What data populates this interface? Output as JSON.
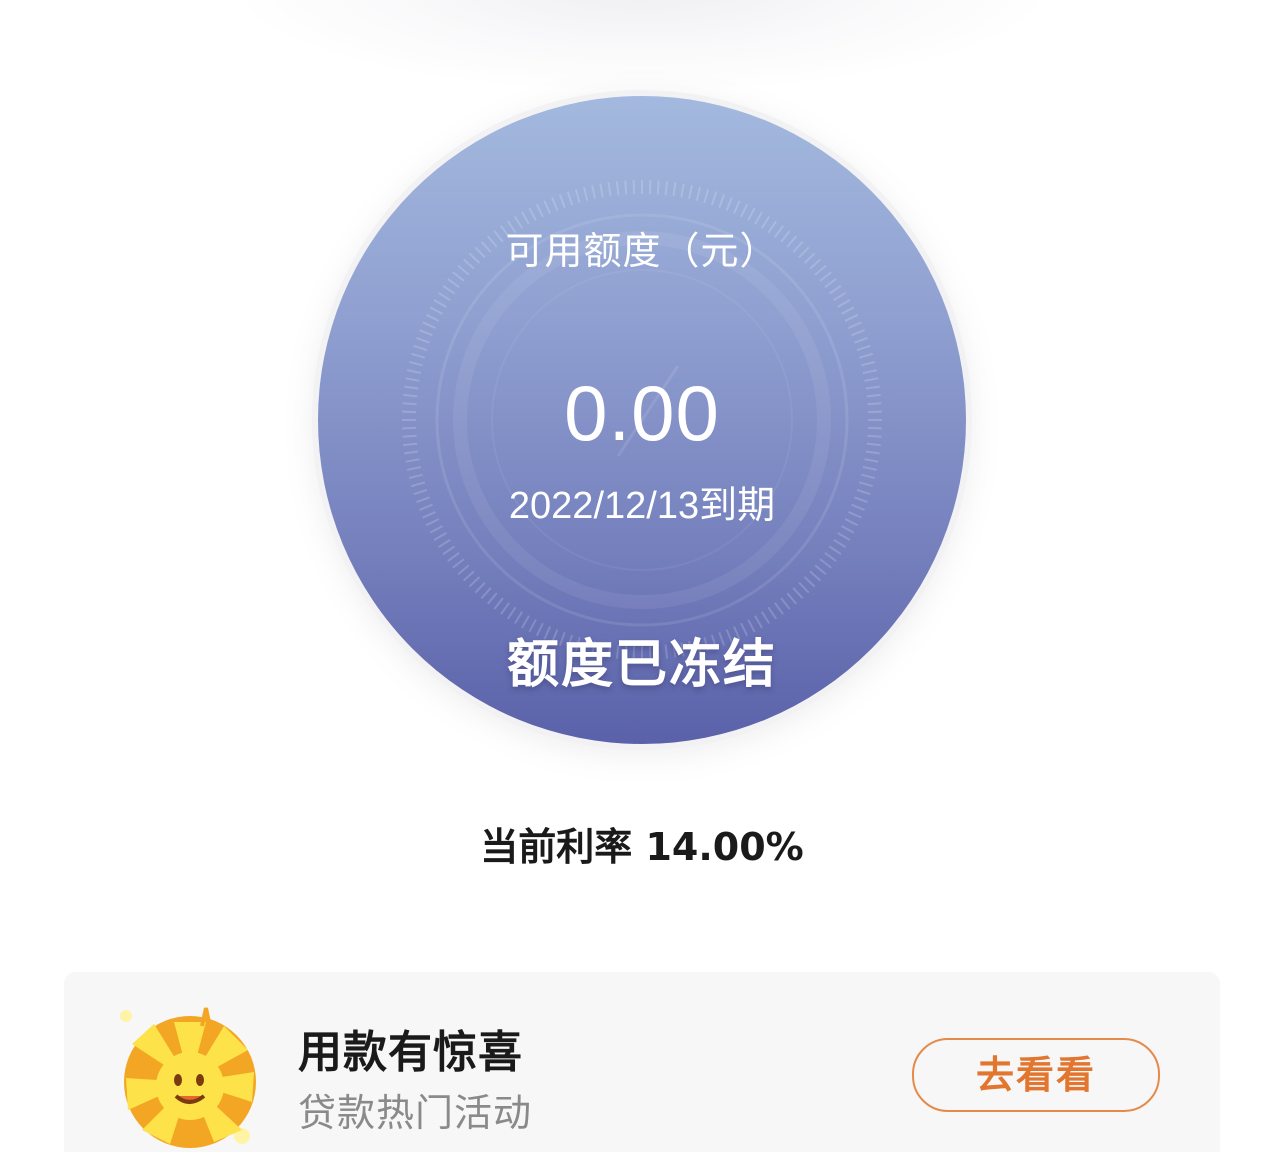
{
  "credit": {
    "label": "可用额度（元）",
    "amount": "0.00",
    "expiry": "2022/12/13到期",
    "status": "额度已冻结"
  },
  "rate": {
    "text": "当前利率 14.00%"
  },
  "promo": {
    "title": "用款有惊喜",
    "subtitle": "贷款热门活动",
    "button_label": "去看看",
    "icon": "sun-mascot-icon"
  },
  "colors": {
    "circle_top": "#a3b9de",
    "circle_bottom": "#5a61a9",
    "accent_orange": "#e2762f",
    "text_dark": "#1a1a1a",
    "text_gray": "#8a8a8a"
  }
}
